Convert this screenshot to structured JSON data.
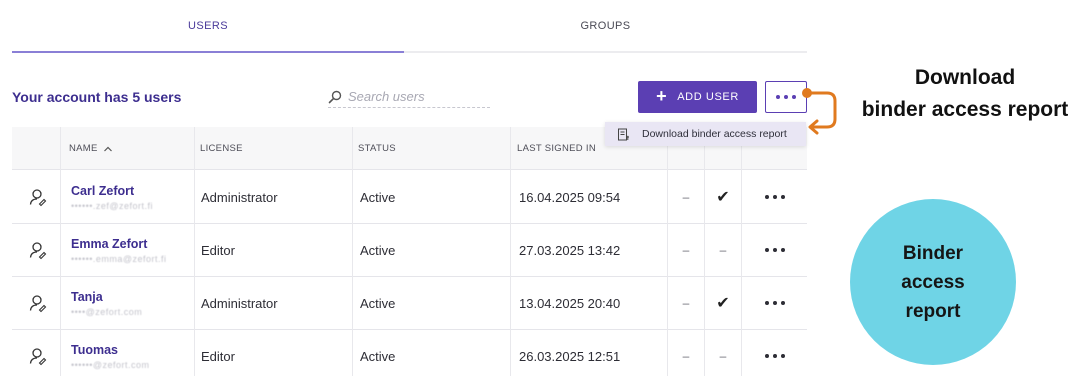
{
  "tabs": [
    {
      "label": "USERS",
      "active": true
    },
    {
      "label": "GROUPS",
      "active": false
    }
  ],
  "toolbar": {
    "user_count_text": "Your account has 5 users",
    "search_placeholder": "Search users",
    "add_user_label": "ADD USER"
  },
  "dropdown": {
    "items": [
      {
        "label": "Download binder access report",
        "icon": "report-icon"
      }
    ]
  },
  "table": {
    "columns": [
      "",
      "NAME",
      "LICENSE",
      "STATUS",
      "LAST SIGNED IN",
      "",
      "",
      ""
    ],
    "name_sort": "ascending",
    "rows": [
      {
        "name": "Carl Zefort",
        "email": "••••••.zef@zefort.fi",
        "license": "Administrator",
        "status": "Active",
        "last_signed_in": "16.04.2025 09:54",
        "col6": "–",
        "col7": "✔"
      },
      {
        "name": "Emma Zefort",
        "email": "••••••.emma@zefort.fi",
        "license": "Editor",
        "status": "Active",
        "last_signed_in": "27.03.2025 13:42",
        "col6": "–",
        "col7": "–"
      },
      {
        "name": "Tanja",
        "email": "••••@zefort.com",
        "license": "Administrator",
        "status": "Active",
        "last_signed_in": "13.04.2025 20:40",
        "col6": "–",
        "col7": "✔"
      },
      {
        "name": "Tuomas",
        "email": "••••••@zefort.com",
        "license": "Editor",
        "status": "Active",
        "last_signed_in": "26.03.2025 12:51",
        "col6": "–",
        "col7": "–"
      }
    ]
  },
  "annotation": {
    "title_line1": "Download",
    "title_line2": "binder access report",
    "circle_line1": "Binder",
    "circle_line2": "access",
    "circle_line3": "report"
  },
  "colors": {
    "accent": "#5b3fb3",
    "accent_text": "#3d2e8f",
    "callout_arrow": "#e07a1f",
    "circle": "#6fd4e6"
  }
}
